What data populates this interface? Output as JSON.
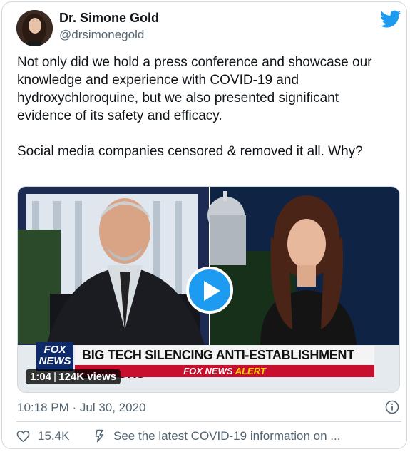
{
  "author": {
    "name": "Dr. Simone Gold",
    "handle": "@drsimonegold"
  },
  "tweet": {
    "text": "Not only did we hold a press conference and showcase our knowledge and experience with COVID-19 and hydroxychloroquine, but we also presented significant evidence of its safety and efficacy.\n\nSocial media companies censored & removed it all. Why?"
  },
  "video": {
    "logo_line1": "FOX",
    "logo_line2": "NEWS",
    "chyron": "BIG TECH SILENCING ANTI-ESTABLISHMENT DOCTORS",
    "alert_brand": "FOX NEWS",
    "alert_word": "ALERT",
    "duration": "1:04",
    "views": "124K views"
  },
  "timestamp": "10:18 PM · Jul 30, 2020",
  "footer": {
    "likes": "15.4K",
    "covid_notice": "See the latest COVID-19 information on ..."
  },
  "colors": {
    "accent": "#1d9bf0",
    "secondary_text": "#536471",
    "fox_red": "#c8102e",
    "fox_blue": "#0d2a6b"
  },
  "icons": [
    "twitter-bird-icon",
    "play-icon",
    "info-icon",
    "heart-icon",
    "info-flag-icon"
  ]
}
